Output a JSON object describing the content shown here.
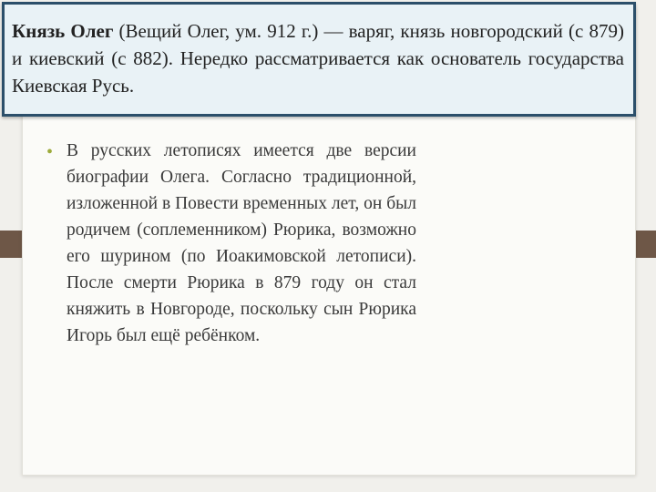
{
  "title": {
    "bold": "Князь Олег",
    "rest": " (Вещий Олег, ум. 912 г.) — варяг, князь новгородский (с 879) и киевский (с 882). Нередко рассматривается как основатель государства Киевская Русь."
  },
  "bullet": {
    "text": "В русских летописях имеется две версии биографии Олега. Согласно традиционной, изложенной в Повести временных лет, он был родичем (соплеменником) Рюрика, возможно его шурином (по Иоакимовской летописи). После смерти Рюрика в 879 году он стал княжить в Новгороде, поскольку сын Рюрика Игорь был ещё ребёнком."
  },
  "colors": {
    "title_border": "#2c4f6a",
    "title_fill": "#e9f2f6",
    "bullet": "#9dab3c",
    "side_bar": "#6e5747"
  }
}
